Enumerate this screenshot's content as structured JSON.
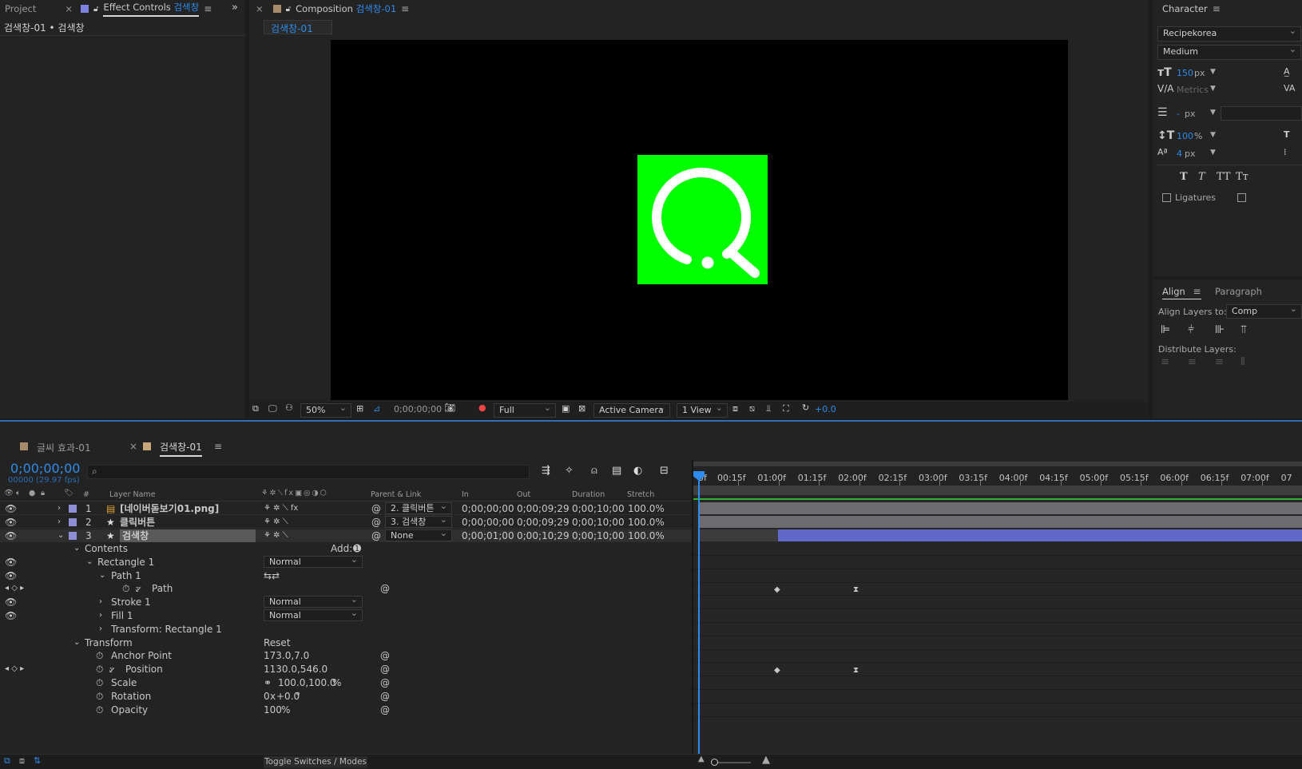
{
  "panels": {
    "project_tab": "Project",
    "effect_controls_tab": "Effect Controls",
    "effect_controls_target": "검색창",
    "effect_controls_breadcrumb": "검색창-01 • 검색창",
    "composition_tab": "Composition",
    "composition_name": "검색창-01",
    "composition_flow_tab": "검색창-01"
  },
  "viewer": {
    "zoom": "50%",
    "timecode": "0;00;00;00",
    "resolution": "Full",
    "camera": "Active Camera",
    "views": "1 View",
    "exposure": "+0.0",
    "shape_color": "#00ff00"
  },
  "character": {
    "title": "Character",
    "font_family": "Recipekorea",
    "font_style": "Medium",
    "font_size": "150",
    "font_size_unit": "px",
    "kerning": "Metrics",
    "leading": "-",
    "leading_unit": "px",
    "vertical_scale": "100",
    "vertical_scale_unit": "%",
    "baseline_shift": "4",
    "baseline_shift_unit": "px",
    "style_buttons": [
      "T",
      "T",
      "TT",
      "Tт"
    ],
    "ligatures": "Ligatures"
  },
  "align": {
    "tab": "Align",
    "paragraph_tab": "Paragraph",
    "align_to_label": "Align Layers to:",
    "align_to_value": "Comp",
    "distribute_label": "Distribute Layers:"
  },
  "timeline": {
    "tabs": [
      {
        "label": "글씨 효과-01",
        "color": "#a58b6a"
      },
      {
        "label": "검색창-01",
        "color": "#c8a77b"
      }
    ],
    "current_time": "0;00;00;00",
    "frame_info": "00000 (29.97 fps)",
    "search_placeholder": "",
    "columns": {
      "num": "#",
      "layer_name": "Layer Name",
      "parent_link": "Parent & Link",
      "in": "In",
      "out": "Out",
      "duration": "Duration",
      "stretch": "Stretch"
    },
    "layers": [
      {
        "index": "1",
        "name": "[네이버돋보기01.png]",
        "parent": "2. 클릭버튼",
        "in": "0;00;00;00",
        "out": "0;00;09;29",
        "duration": "0;00;10;00",
        "stretch": "100.0%",
        "label_color": "#8d8ed6"
      },
      {
        "index": "2",
        "name": "클릭버튼",
        "parent": "3. 검색창",
        "in": "0;00;00;00",
        "out": "0;00;09;29",
        "duration": "0;00;10;00",
        "stretch": "100.0%",
        "label_color": "#8d8ed6"
      },
      {
        "index": "3",
        "name": "검색창",
        "parent": "None",
        "in": "0;00;01;00",
        "out": "0;00;10;29",
        "duration": "0;00;10;00",
        "stretch": "100.0%",
        "label_color": "#8d8ed6"
      }
    ],
    "props": {
      "contents": "Contents",
      "add_label": "Add:",
      "rectangle": "Rectangle 1",
      "rectangle_blend": "Normal",
      "path_group": "Path 1",
      "path": "Path",
      "stroke": "Stroke 1",
      "stroke_blend": "Normal",
      "fill": "Fill 1",
      "fill_blend": "Normal",
      "transform_rect": "Transform: Rectangle 1",
      "transform": "Transform",
      "reset": "Reset",
      "anchor_label": "Anchor Point",
      "anchor_value": "173.0,7.0",
      "position_label": "Position",
      "position_value": "1130.0,546.0",
      "scale_label": "Scale",
      "scale_value": "100.0,100.0",
      "scale_unit": "%",
      "rotation_label": "Rotation",
      "rotation_turns": "0",
      "rotation_x": "x",
      "rotation_deg": "+0.0",
      "rotation_unit": "°",
      "opacity_label": "Opacity",
      "opacity_value": "100",
      "opacity_unit": "%"
    },
    "ruler_ticks": [
      "0f",
      "00:15f",
      "01:00f",
      "01:15f",
      "02:00f",
      "02:15f",
      "03:00f",
      "03:15f",
      "04:00f",
      "04:15f",
      "05:00f",
      "05:15f",
      "06:00f",
      "06:15f",
      "07:00f",
      "07"
    ],
    "toggle_label": "Toggle Switches / Modes"
  }
}
